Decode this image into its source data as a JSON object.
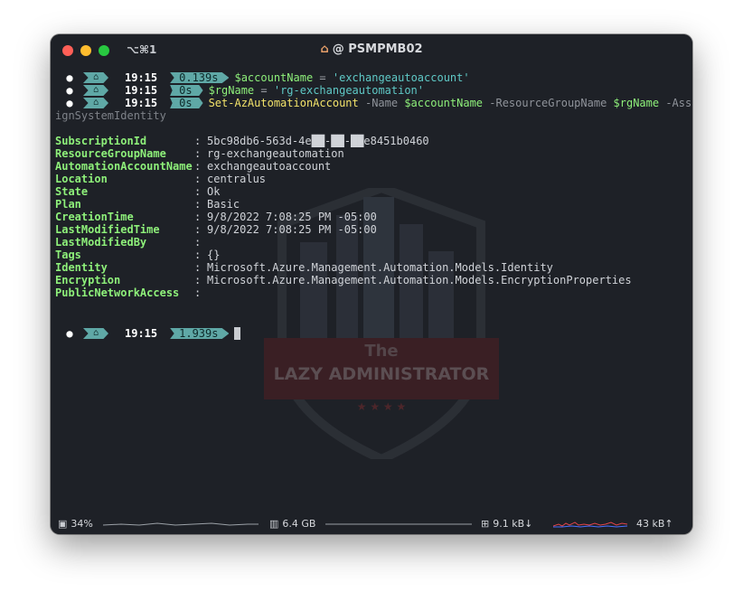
{
  "window": {
    "shortcut": "⌥⌘1",
    "title_icon": "house-icon",
    "title": "@ PSMPMB02"
  },
  "prompts": [
    {
      "time": "19:15",
      "duration": "0.139s",
      "command": {
        "var": "$accountName",
        "op": " = ",
        "str": "'exchangeautoaccount'"
      }
    },
    {
      "time": "19:15",
      "duration": "0s",
      "command": {
        "var": "$rgName",
        "op": " = ",
        "str": "'rg-exchangeautomation'"
      }
    },
    {
      "time": "19:15",
      "duration": "0s",
      "command": {
        "cmdlet": "Set-AzAutomationAccount",
        "p1": " -Name ",
        "v1": "$accountName",
        "p2": " -ResourceGroupName ",
        "v2": "$rgName",
        "p3": " -Ass"
      }
    }
  ],
  "wrapped_continuation": "ignSystemIdentity",
  "output": [
    {
      "key": "SubscriptionId",
      "value": "5bc98db6-563d-4e██-██-██e8451b0460"
    },
    {
      "key": "ResourceGroupName",
      "value": "rg-exchangeautomation"
    },
    {
      "key": "AutomationAccountName",
      "value": "exchangeautoaccount"
    },
    {
      "key": "Location",
      "value": "centralus"
    },
    {
      "key": "State",
      "value": "Ok"
    },
    {
      "key": "Plan",
      "value": "Basic"
    },
    {
      "key": "CreationTime",
      "value": "9/8/2022 7:08:25 PM -05:00"
    },
    {
      "key": "LastModifiedTime",
      "value": "9/8/2022 7:08:25 PM -05:00"
    },
    {
      "key": "LastModifiedBy",
      "value": ""
    },
    {
      "key": "Tags",
      "value": "{}"
    },
    {
      "key": "Identity",
      "value": "Microsoft.Azure.Management.Automation.Models.Identity"
    },
    {
      "key": "Encryption",
      "value": "Microsoft.Azure.Management.Automation.Models.EncryptionProperties"
    },
    {
      "key": "PublicNetworkAccess",
      "value": ""
    }
  ],
  "separator": ":",
  "final_prompt": {
    "time": "19:15",
    "duration": "1.939s"
  },
  "watermark": {
    "line1": "The",
    "line2": "LAZY ADMINISTRATOR",
    "stars": "★ ★ ★ ★"
  },
  "statusbar": {
    "cpu": "34%",
    "memory": "6.4 GB",
    "net_down": "9.1 kB↓",
    "net_up": "43 kB↑",
    "colors": {
      "spark_line": "#9aa0a6",
      "net_red": "#e0444a",
      "net_blue": "#4c6fff"
    }
  }
}
